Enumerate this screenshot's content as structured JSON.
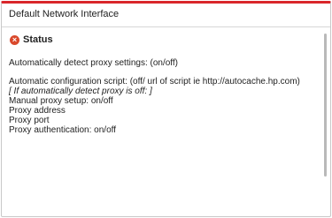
{
  "window": {
    "title": "Default Network Interface",
    "accent_color": "#d9262a"
  },
  "status": {
    "icon": "close-circle-icon",
    "icon_color": "#d9482b",
    "title": "Status"
  },
  "lines": [
    "Automatically detect proxy settings: (on/off)",
    "Automatic configuration script: (off/ url of script ie http://autocache.hp.com)",
    "[ If automatically detect proxy is off: ]",
    "Manual proxy setup: on/off",
    "Proxy address",
    "Proxy port",
    "Proxy authentication: on/off"
  ]
}
